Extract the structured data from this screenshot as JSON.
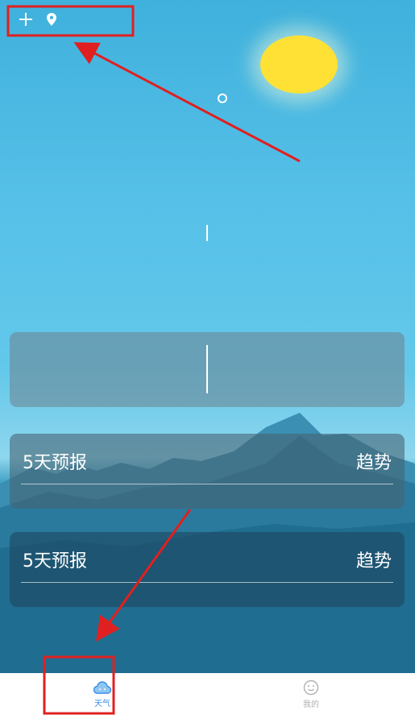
{
  "topbar": {
    "add_icon": "plus-icon",
    "location_icon": "location-pin-icon"
  },
  "sky": {
    "sun_color": "#ffe135"
  },
  "forecast_cards": [
    {
      "title": "5天预报",
      "link": "趋势"
    },
    {
      "title": "5天预报",
      "link": "趋势"
    }
  ],
  "tabbar": {
    "tabs": [
      {
        "label": "天气",
        "icon": "cloud-icon",
        "active": true,
        "color": "#3a8ee6"
      },
      {
        "label": "我的",
        "icon": "smiley-icon",
        "active": false,
        "color": "#b0b0b0"
      }
    ]
  },
  "annotation_color": "#e02020"
}
